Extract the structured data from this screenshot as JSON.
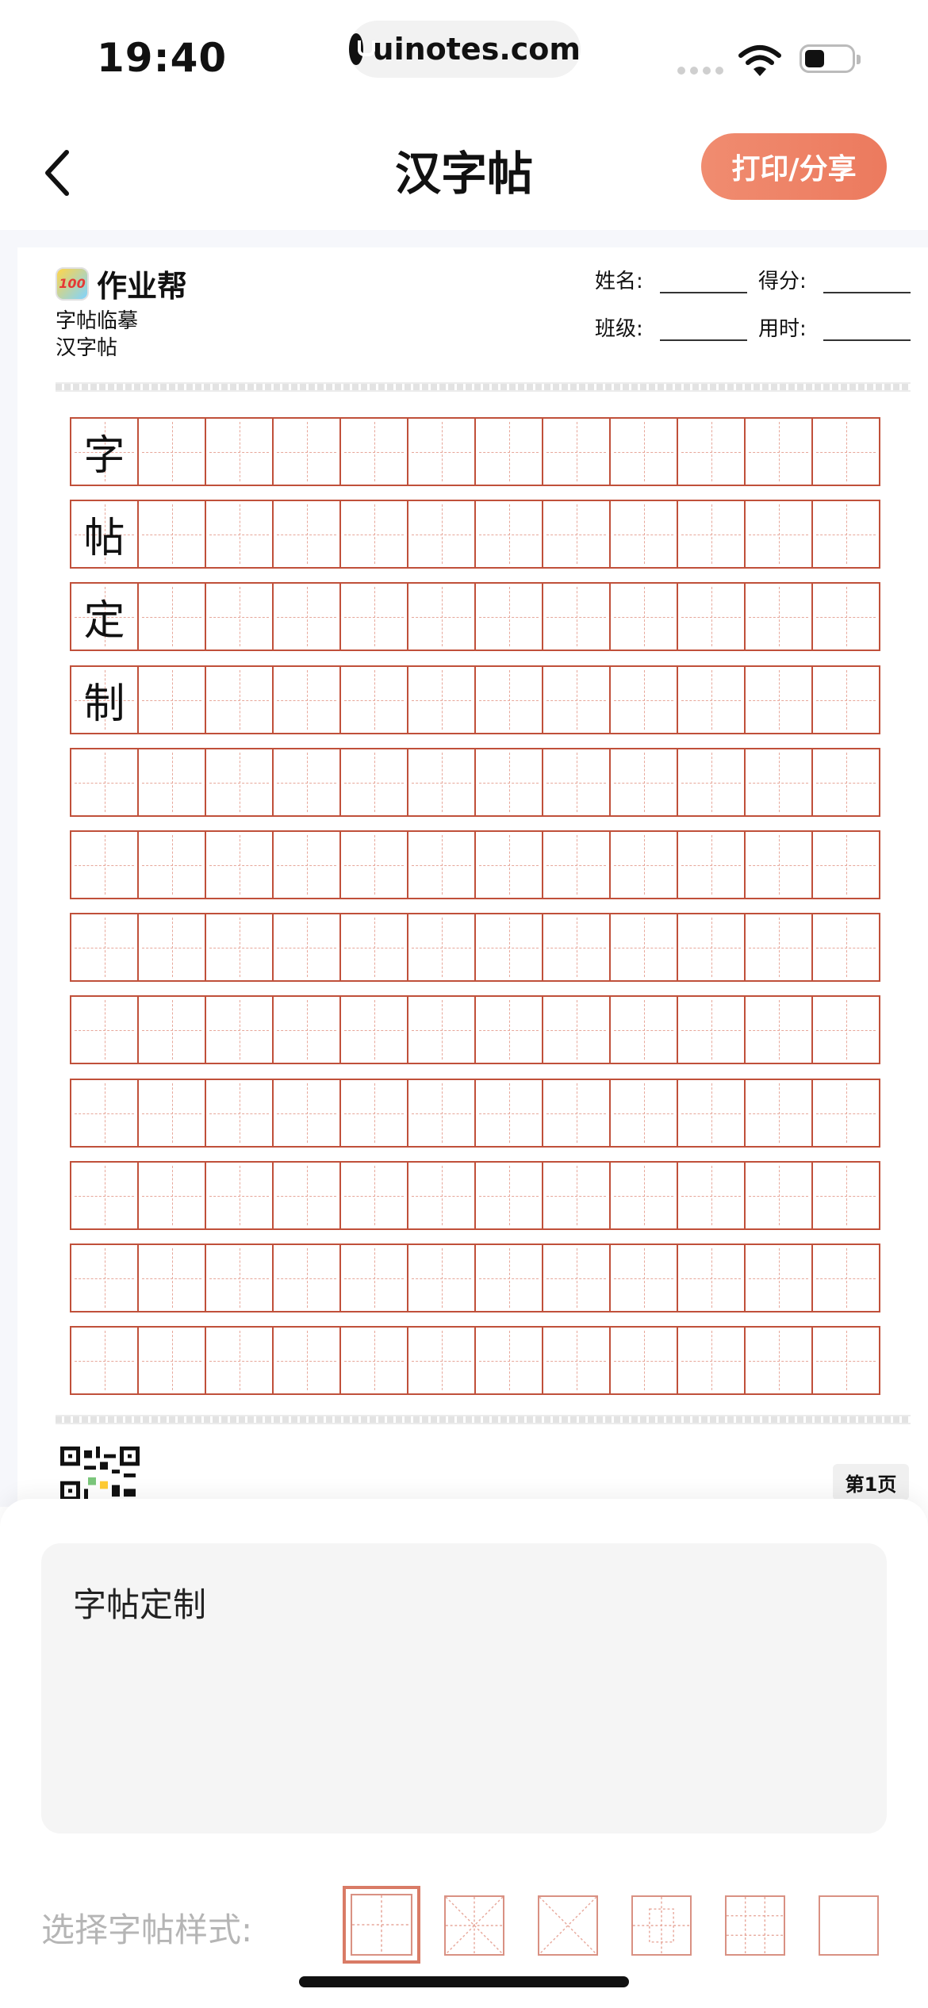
{
  "status": {
    "time": "19:40",
    "url": "uinotes.com"
  },
  "nav": {
    "title": "汉字帖",
    "print_button": "打印/分享"
  },
  "sheet_header": {
    "brand": "作业帮",
    "brand_logo_text": "100",
    "subtitle1": "字帖临摹",
    "subtitle2": "汉字帖",
    "fields": {
      "name": "姓名:",
      "score": "得分:",
      "class": "班级:",
      "time": "用时:"
    }
  },
  "grid": {
    "rows": 12,
    "cols": 12,
    "first_column_chars": [
      "字",
      "帖",
      "定",
      "制"
    ]
  },
  "page_label": "第1页",
  "editor": {
    "text_value": "字帖定制",
    "style_label": "选择字帖样式:"
  },
  "style_options": [
    "tian-ge",
    "mi-ge",
    "cross-ge",
    "hui-gong-ge",
    "jiu-gong-ge",
    "fang-ge"
  ],
  "selected_style_index": 0,
  "colors": {
    "accent": "#ec7a5e",
    "grid_border": "#c0503a",
    "grid_guides": "#e7a79a"
  }
}
